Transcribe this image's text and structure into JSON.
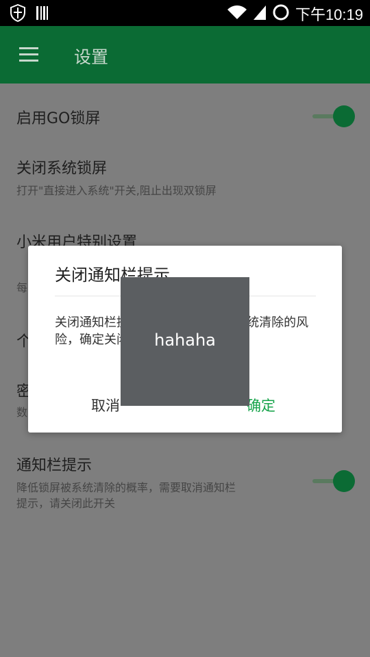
{
  "status_bar": {
    "time": "下午10:19",
    "icons": [
      "shield-icon",
      "barcode-icon",
      "wifi-icon",
      "cell-signal-icon",
      "ring-icon"
    ]
  },
  "app_bar": {
    "title": "设置",
    "menu_icon": "hamburger-menu-icon"
  },
  "settings": {
    "items": [
      {
        "title": "启用GO锁屏",
        "toggle_on": true
      },
      {
        "title": "关闭系统锁屏",
        "subtitle": "打开\"直接进入系统\"开关,阻止出现双锁屏"
      },
      {
        "title": "小米用户特别设置",
        "subtitle": "每"
      },
      {
        "title": "个"
      },
      {
        "title": "密",
        "subtitle": "数"
      },
      {
        "title": "通知栏提示",
        "subtitle_line1": "降低锁屏被系统清除的概率，需要取消通知栏",
        "subtitle_line2": "提示，请关闭此开关",
        "toggle_on": true
      }
    ]
  },
  "dialog": {
    "title": "关闭通知栏提示",
    "message": "关闭通知栏提示，存在GO锁屏被系统清除的风险，确定关闭？",
    "cancel_label": "取消",
    "confirm_label": "确定"
  },
  "toast": {
    "text": "hahaha"
  },
  "colors": {
    "accent": "#0b6b34",
    "confirm": "#16a34a",
    "scrim_background": "#7e7e7e"
  }
}
